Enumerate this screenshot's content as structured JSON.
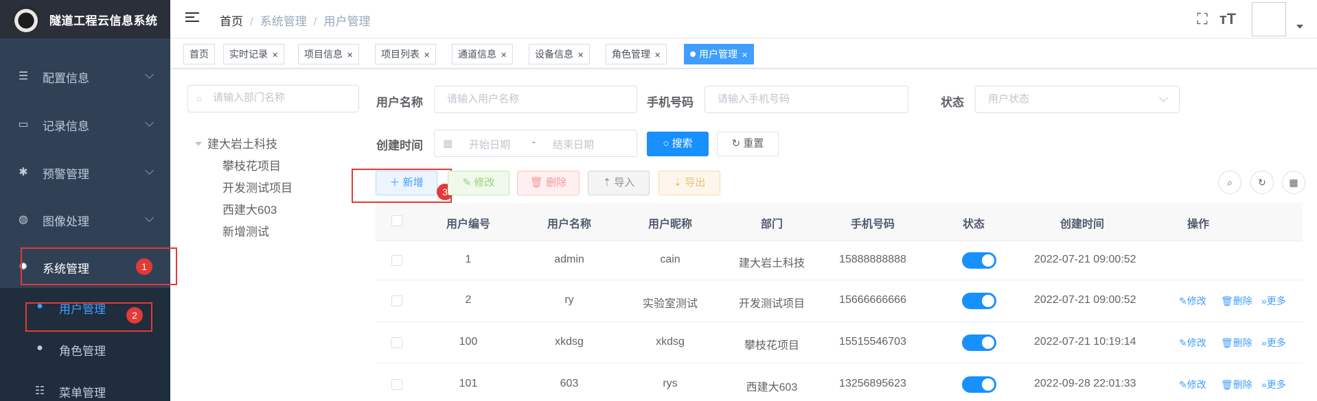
{
  "app": {
    "title": "隧道工程云信息系统"
  },
  "sidebar": {
    "menu": [
      {
        "label": "配置信息",
        "icon": "sliders-icon"
      },
      {
        "label": "记录信息",
        "icon": "monitor-icon"
      },
      {
        "label": "预警管理",
        "icon": "bug-icon"
      },
      {
        "label": "图像处理",
        "icon": "globe-icon"
      },
      {
        "label": "系统管理",
        "icon": "gear-icon"
      }
    ],
    "submenu": [
      {
        "label": "用户管理",
        "icon": "user-icon"
      },
      {
        "label": "角色管理",
        "icon": "users-icon"
      },
      {
        "label": "菜单管理",
        "icon": "tree-menu-icon"
      }
    ]
  },
  "annotations": {
    "badge1": "1",
    "badge2": "2",
    "badge3": "3"
  },
  "breadcrumb": {
    "home": "首页",
    "level1": "系统管理",
    "level2": "用户管理",
    "sep": "/"
  },
  "tags": [
    {
      "label": "首页"
    },
    {
      "label": "实时记录"
    },
    {
      "label": "项目信息"
    },
    {
      "label": "项目列表"
    },
    {
      "label": "通道信息"
    },
    {
      "label": "设备信息"
    },
    {
      "label": "角色管理"
    },
    {
      "label": "用户管理"
    }
  ],
  "dept": {
    "search_placeholder": "请输入部门名称",
    "root": "建大岩土科技",
    "children": [
      "攀枝花项目",
      "开发测试项目",
      "西建大603",
      "新增测试"
    ]
  },
  "filters": {
    "username_label": "用户名称",
    "username_placeholder": "请输入用户名称",
    "phone_label": "手机号码",
    "phone_placeholder": "请输入手机号码",
    "status_label": "状态",
    "status_placeholder": "用户状态",
    "created_label": "创建时间",
    "start_placeholder": "开始日期",
    "range_sep": "-",
    "end_placeholder": "结束日期",
    "search_btn": "搜索",
    "reset_btn": "重置"
  },
  "toolbar": {
    "add": "新增",
    "edit": "修改",
    "delete": "删除",
    "import": "导入",
    "export": "导出"
  },
  "table": {
    "headers": [
      "用户编号",
      "用户名称",
      "用户昵称",
      "部门",
      "手机号码",
      "状态",
      "创建时间",
      "操作"
    ],
    "rows": [
      {
        "id": "1",
        "name": "admin",
        "nick": "cain",
        "dept": "建大岩土科技",
        "phone": "15888888888",
        "enabled": true,
        "created": "2022-07-21 09:00:52",
        "ops": false
      },
      {
        "id": "2",
        "name": "ry",
        "nick": "实验室测试",
        "dept": "开发测试项目",
        "phone": "15666666666",
        "enabled": true,
        "created": "2022-07-21 09:00:52",
        "ops": true
      },
      {
        "id": "100",
        "name": "xkdsg",
        "nick": "xkdsg",
        "dept": "攀枝花项目",
        "phone": "15515546703",
        "enabled": true,
        "created": "2022-07-21 10:19:14",
        "ops": true
      },
      {
        "id": "101",
        "name": "603",
        "nick": "rys",
        "dept": "西建大603",
        "phone": "13256895623",
        "enabled": true,
        "created": "2022-09-28 22:01:33",
        "ops": true
      }
    ],
    "op_edit": "修改",
    "op_delete": "删除",
    "op_more": "更多"
  },
  "colors": {
    "sidebar_bg": "#304156",
    "submenu_bg": "#1f2d3d",
    "primary": "#1890ff",
    "annotation_red": "#e53935"
  }
}
